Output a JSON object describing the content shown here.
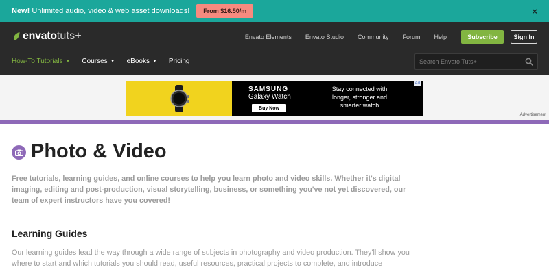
{
  "promo": {
    "lead": "New!",
    "text": "Unlimited audio, video & web asset downloads!",
    "button": "From $16.50/m",
    "close": "×"
  },
  "header": {
    "logo_envato": "envato",
    "logo_tuts": "tuts+",
    "top_links": [
      "Envato Elements",
      "Envato Studio",
      "Community",
      "Forum",
      "Help"
    ],
    "subscribe": "Subscribe",
    "sign_in": "Sign In",
    "nav": [
      {
        "label": "How-To Tutorials",
        "has_caret": true,
        "active": true
      },
      {
        "label": "Courses",
        "has_caret": true,
        "active": false
      },
      {
        "label": "eBooks",
        "has_caret": true,
        "active": false
      },
      {
        "label": "Pricing",
        "has_caret": false,
        "active": false
      }
    ],
    "search_placeholder": "Search Envato Tuts+"
  },
  "ad": {
    "brand": "SAMSUNG",
    "product": "Galaxy Watch",
    "cta": "Buy Now",
    "copy": "Stay connected with longer, stronger and smarter watch",
    "tag": "Ad",
    "advertisement_label": "Advertisement"
  },
  "main": {
    "icon": "camera-icon",
    "title": "Photo & Video",
    "intro": "Free tutorials, learning guides, and online courses to help you learn photo and video skills. Whether it's digital imaging, editing and post-production, visual storytelling, business, or something you've not yet discovered, our team of expert instructors have you covered!",
    "learning_guides_title": "Learning Guides",
    "learning_guides_text": "Our learning guides lead the way through a wide range of subjects in photography and video production. They'll show you where to start and which tutorials you should read, useful resources, practical projects to complete, and introduce"
  },
  "colors": {
    "promo_bg": "#1ba79b",
    "header_bg": "#2a2a2a",
    "accent_green": "#82b541",
    "category_purple": "#8e69b8"
  }
}
